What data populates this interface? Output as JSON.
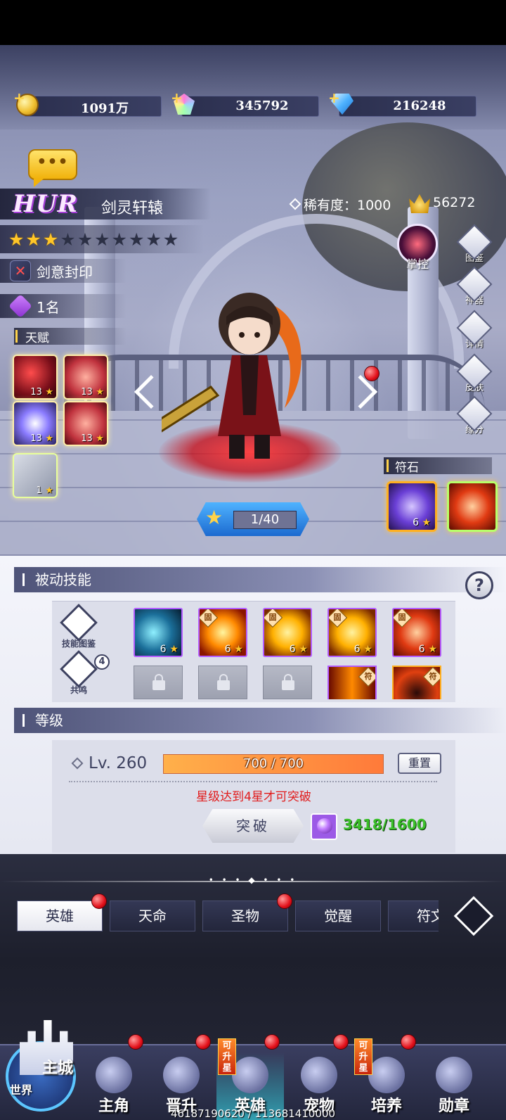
{
  "currency": {
    "gold": "1091万",
    "crystal": "345792",
    "diamond": "216248"
  },
  "hero": {
    "grade": "HUR",
    "name": "剑灵轩辕",
    "rarity_label": "稀有度：1000",
    "power": "56272",
    "stars_total": 10,
    "stars_filled": 3,
    "seal": "剑意封印",
    "rank": "1名",
    "talent_title": "天赋",
    "talents": [
      {
        "level": "13",
        "style": "t-red"
      },
      {
        "level": "13",
        "style": "t-rose"
      },
      {
        "level": "13",
        "style": "t-blue"
      },
      {
        "level": "13",
        "style": "t-rose"
      },
      {
        "level": "1",
        "style": "t-grey"
      }
    ],
    "ascend_progress": "1/40",
    "control_skill": "掌控"
  },
  "side_menu": [
    {
      "label": "图鉴",
      "icon": "book-icon"
    },
    {
      "label": "神器",
      "icon": "artifact-icon"
    },
    {
      "label": "详情",
      "icon": "magnifier-icon"
    },
    {
      "label": "皮肤",
      "icon": "skin-icon"
    },
    {
      "label": "缘分",
      "icon": "heart-icon"
    }
  ],
  "runes": {
    "title": "符石",
    "items": [
      {
        "level": "6"
      },
      {
        "level": ""
      }
    ]
  },
  "passive": {
    "title": "被动技能",
    "help": "?",
    "codex_label": "技能图鉴",
    "resonance_label": "共鸣",
    "resonance_count": "4",
    "fixed_tag": "固",
    "rune_tag": "符",
    "skills": [
      {
        "level": "6",
        "fixed": false,
        "style": "s-ice"
      },
      {
        "level": "6",
        "fixed": true,
        "style": "s-fire"
      },
      {
        "level": "6",
        "fixed": true,
        "style": "s-gold"
      },
      {
        "level": "6",
        "fixed": true,
        "style": "s-gold"
      },
      {
        "level": "6",
        "fixed": true,
        "style": "s-blade"
      }
    ]
  },
  "level": {
    "title": "等级",
    "level_text": "Lv. 260",
    "xp_text": "700 / 700",
    "xp_fraction": 1.0,
    "reset_label": "重置",
    "warning": "星级达到4星才可突破",
    "break_label": "突破",
    "material_count": "3418/1600"
  },
  "tabs": [
    {
      "label": "英雄",
      "active": true,
      "dot": true
    },
    {
      "label": "天命",
      "active": false,
      "dot": false
    },
    {
      "label": "圣物",
      "active": false,
      "dot": true
    },
    {
      "label": "觉醒",
      "active": false,
      "dot": false
    },
    {
      "label": "符文",
      "active": false,
      "dot": false
    }
  ],
  "nav": {
    "main_city": "主城",
    "world": "世界",
    "upgrade_tag": "可升星",
    "items": [
      {
        "label": "主角",
        "dot": true
      },
      {
        "label": "晋升",
        "dot": true
      },
      {
        "label": "英雄",
        "dot": true,
        "active": true,
        "tag": true
      },
      {
        "label": "宠物",
        "dot": true
      },
      {
        "label": "培养",
        "dot": true,
        "tag": true
      },
      {
        "label": "勋章",
        "dot": false
      }
    ]
  },
  "footer": "46187190620 / 113681410000",
  "colors": {
    "accent": "#ffc628",
    "warning": "#e11b1b",
    "material": "#3bbf2a"
  }
}
